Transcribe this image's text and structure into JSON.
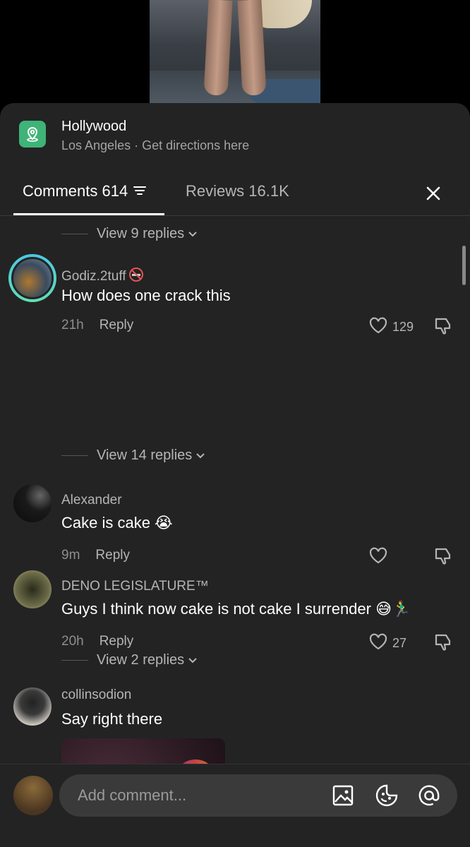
{
  "location": {
    "title": "Hollywood",
    "subtitle": "Los Angeles · Get directions here"
  },
  "tabs": {
    "comments_label": "Comments 614",
    "reviews_label": "Reviews 16.1K"
  },
  "replies": {
    "first": "View 9 replies",
    "second": "View 14 replies",
    "third": "View 2 replies"
  },
  "comments": [
    {
      "username": "Godiz.2tuff",
      "text": "How does one crack this",
      "time": "21h",
      "reply": "Reply",
      "likes": "129"
    },
    {
      "username": "Alexander",
      "text": "Cake is cake 😭",
      "time": "9m",
      "reply": "Reply",
      "likes": ""
    },
    {
      "username": "DENO LEGISLATURE™",
      "text": "Guys I think now cake is not cake I surrender 😅🏃‍♂️",
      "time": "20h",
      "reply": "Reply",
      "likes": "27"
    },
    {
      "username": "collinsodion",
      "text": "Say right there"
    }
  ],
  "composer": {
    "placeholder": "Add comment..."
  },
  "icons": [
    "map-pin-icon",
    "filter-icon",
    "close-icon",
    "chevron-down-icon",
    "heart-icon",
    "dislike-icon",
    "image-icon",
    "emoji-icon",
    "mention-icon"
  ],
  "colors": {
    "sheet": "#232323",
    "accent_green": "#3fb378",
    "muted": "#b5b5b5"
  }
}
